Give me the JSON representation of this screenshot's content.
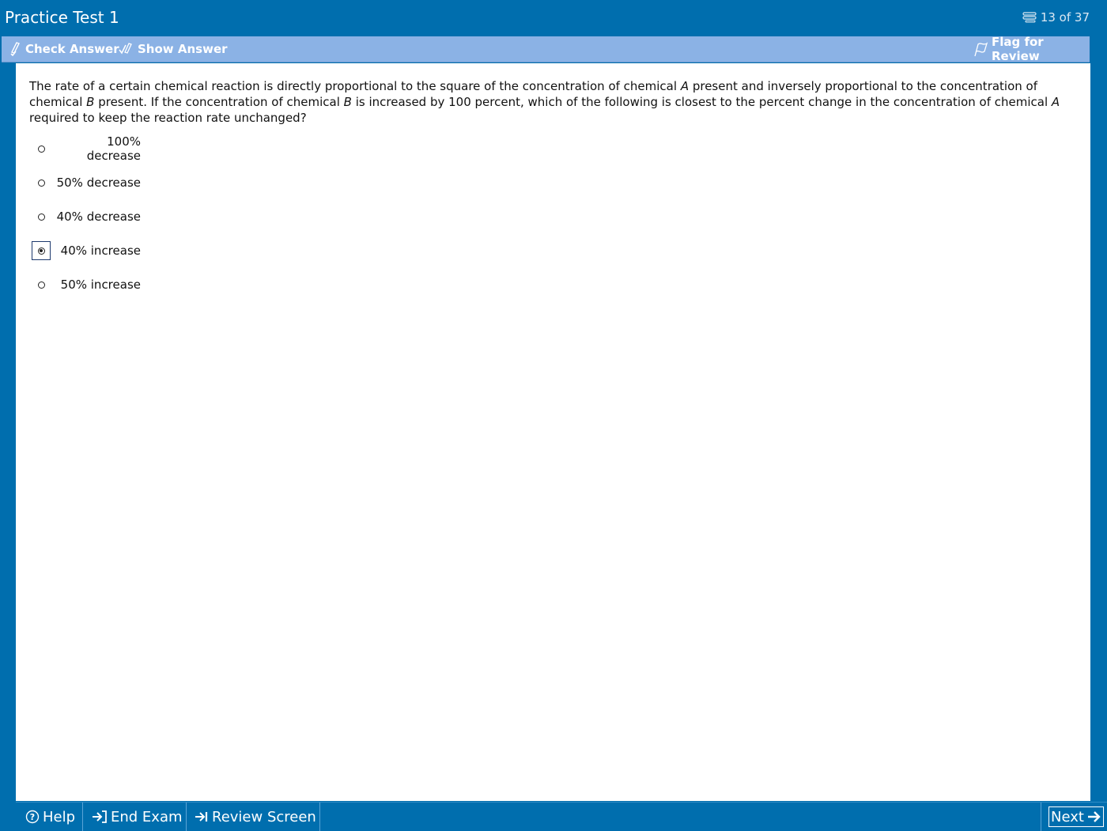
{
  "titlebar": {
    "title": "Practice Test 1",
    "counter": "13 of 37",
    "counter_icon": "list-icon"
  },
  "toolbar": {
    "check_answer": "Check Answer",
    "show_answer": "Show Answer",
    "flag_for_review": "Flag for Review"
  },
  "question": {
    "line_parts": [
      "The rate of a certain chemical reaction is directly proportional to the square of the concentration of chemical ",
      "A",
      " present and inversely proportional to the concentration of",
      "chemical ",
      "B",
      " present.  If the concentration of chemical ",
      "B",
      " is increased by 100 percent, which of the following is closest to the percent change in the concentration of chemical ",
      "A",
      " required to keep the reaction rate unchanged?"
    ]
  },
  "choices": [
    {
      "label": "100% decrease",
      "selected": false
    },
    {
      "label": "50% decrease",
      "selected": false
    },
    {
      "label": "40% decrease",
      "selected": false
    },
    {
      "label": "40% increase",
      "selected": true
    },
    {
      "label": "50% increase",
      "selected": false
    }
  ],
  "bottombar": {
    "help": "Help",
    "end_exam": "End Exam",
    "review_screen": "Review Screen",
    "next": "Next"
  }
}
